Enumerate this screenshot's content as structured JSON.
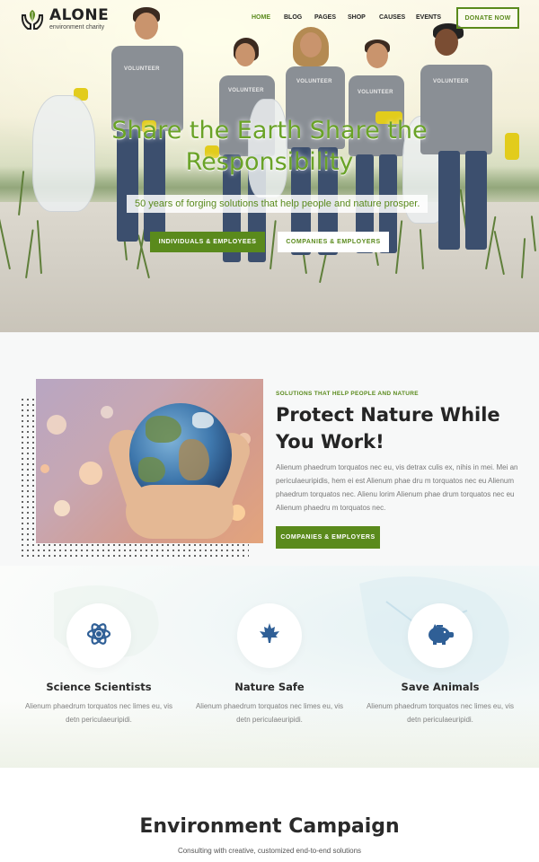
{
  "brand": {
    "name": "ALONE",
    "tagline": "environment charity",
    "accent": "#5a8a1c",
    "accent_light": "#6aa327"
  },
  "nav": {
    "items": [
      "HOME",
      "BLOG",
      "PAGES",
      "SHOP",
      "CAUSES",
      "EVENTS"
    ],
    "active": "HOME",
    "donate_label": "DONATE NOW"
  },
  "hero": {
    "title": "Share the Earth Share the Responsibility",
    "subtitle": "50 years of forging solutions that help people and nature prosper.",
    "primary_button": "INDIVIDUALS & EMPLOYEES",
    "secondary_button": "COMPANIES & EMPLOYERS",
    "shirt_text": "VOLUNTEER"
  },
  "about": {
    "kicker": "SOLUTIONS THAT HELP PEOPLE AND NATURE",
    "title": "Protect Nature While You Work!",
    "body": "Alienum phaedrum torquatos nec eu, vis detrax culis ex, nihis in mei. Mei an periculaeuripidis, hem ei est Alienum phae dru m torquatos nec eu Alienum phaedrum torquatos nec. Alienu lorim Alienum phae drum torquatos nec eu Alienum phaedru m torquatos nec.",
    "button": "COMPANIES & EMPLOYERS"
  },
  "features": [
    {
      "icon": "atom-icon",
      "title": "Science Scientists",
      "body": "Alienum phaedrum torquatos nec limes eu, vis detn periculaeuripidi."
    },
    {
      "icon": "maple-leaf-icon",
      "title": "Nature Safe",
      "body": "Alienum phaedrum torquatos nec limes eu, vis detn periculaeuripidi."
    },
    {
      "icon": "piggy-bank-icon",
      "title": "Save Animals",
      "body": "Alienum phaedrum torquatos nec limes eu, vis detn periculaeuripidi."
    }
  ],
  "campaign": {
    "title": "Environment Campaign",
    "subtitle": "Consulting with creative, customized end-to-end solutions"
  }
}
